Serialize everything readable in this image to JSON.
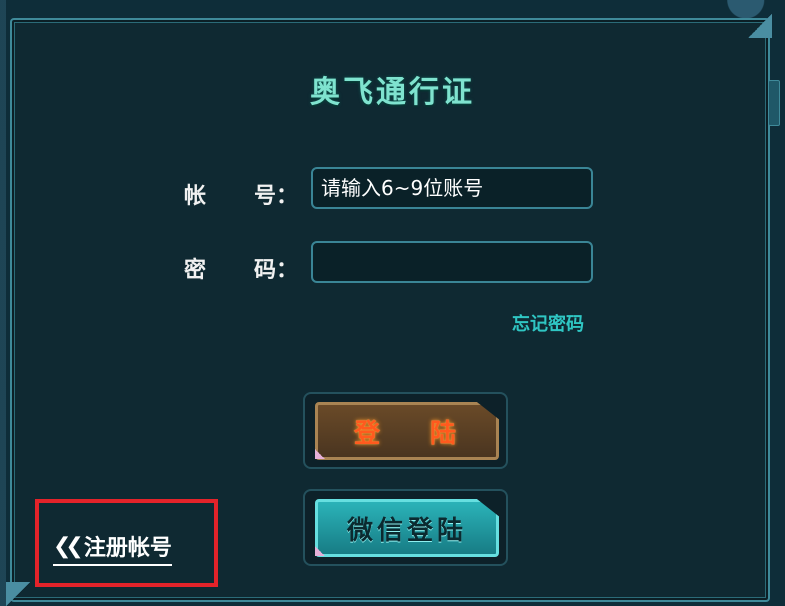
{
  "title": "奥飞通行证",
  "form": {
    "username_label_a": "帐",
    "username_label_b": "号：",
    "username_placeholder": "请输入6~9位账号",
    "password_label_a": "密",
    "password_label_b": "码：",
    "password_value": ""
  },
  "forgot_label": "忘记密码",
  "login": {
    "label_a": "登",
    "label_b": "陆"
  },
  "wechat_label": "微信登陆",
  "register": {
    "icon": "double-chevron-left-icon",
    "label": "注册帐号"
  },
  "colors": {
    "accent_teal": "#7fe3cf",
    "login_text": "#ff5a1e",
    "highlight_red": "#e3232a"
  }
}
